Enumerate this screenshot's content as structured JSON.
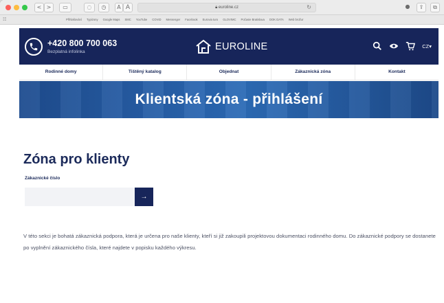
{
  "browser": {
    "url": "euroline.cz",
    "bookmarks": [
      "Přihlašování",
      "Typizony",
      "Google Maps",
      "SMC",
      "YouTube",
      "COVID",
      "Messenger",
      "Facebook",
      "Eurovia turo",
      "GLOVIMC",
      "Počasie Bratislava",
      "DOK DATA",
      "Web brožur"
    ],
    "buttons": {
      "back": "<",
      "forward": ">",
      "text_small": "A",
      "text_large": "A"
    }
  },
  "header": {
    "phone": "+420 800 700 063",
    "phone_sub": "Bezplatná infolinka",
    "logo": "EUROLINE",
    "lang": "CZ▾"
  },
  "nav": [
    "Rodinné domy",
    "Tištěný katalog",
    "Objednat",
    "Zákaznická zóna",
    "Kontakt"
  ],
  "banner": {
    "title": "Klientská zóna - přihlášení"
  },
  "main": {
    "title": "Zóna pro klienty",
    "field_label": "Zákaznické číslo",
    "field_value": "",
    "submit": "→",
    "description": "V této sekci je bohatá zákaznická podpora, která je určena pro naše klienty, kteří si již zakoupili projektovou dokumentaci rodinného domu. Do zákaznické podpory se dostanete po vyplnění zákaznického čísla, které najdete v popisku každého výkresu."
  },
  "colors": {
    "brand_navy": "#17255a",
    "banner_blue": "#2a66b1"
  }
}
